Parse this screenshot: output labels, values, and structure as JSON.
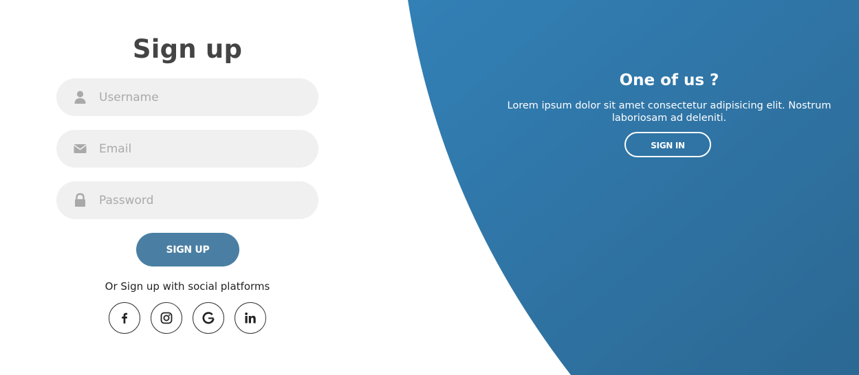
{
  "colors": {
    "accent": "#4a7fa3",
    "panel_gradient_start": "#3280b6",
    "panel_gradient_end": "#2c6893",
    "input_bg": "#f0f0f0",
    "placeholder": "#aaaaaa"
  },
  "signup": {
    "title": "Sign up",
    "username": {
      "placeholder": "Username",
      "value": "",
      "icon": "user-icon"
    },
    "email": {
      "placeholder": "Email",
      "value": "",
      "icon": "envelope-icon"
    },
    "password": {
      "placeholder": "Password",
      "value": "",
      "icon": "lock-icon"
    },
    "submit_label": "SIGN UP",
    "social_text": "Or Sign up with social platforms",
    "social_icons": [
      "facebook-icon",
      "instagram-icon",
      "google-icon",
      "linkedin-icon"
    ]
  },
  "panel": {
    "title": "One of us ?",
    "text": "Lorem ipsum dolor sit amet consectetur adipisicing elit. Nostrum laboriosam ad deleniti.",
    "button_label": "SIGN IN"
  }
}
